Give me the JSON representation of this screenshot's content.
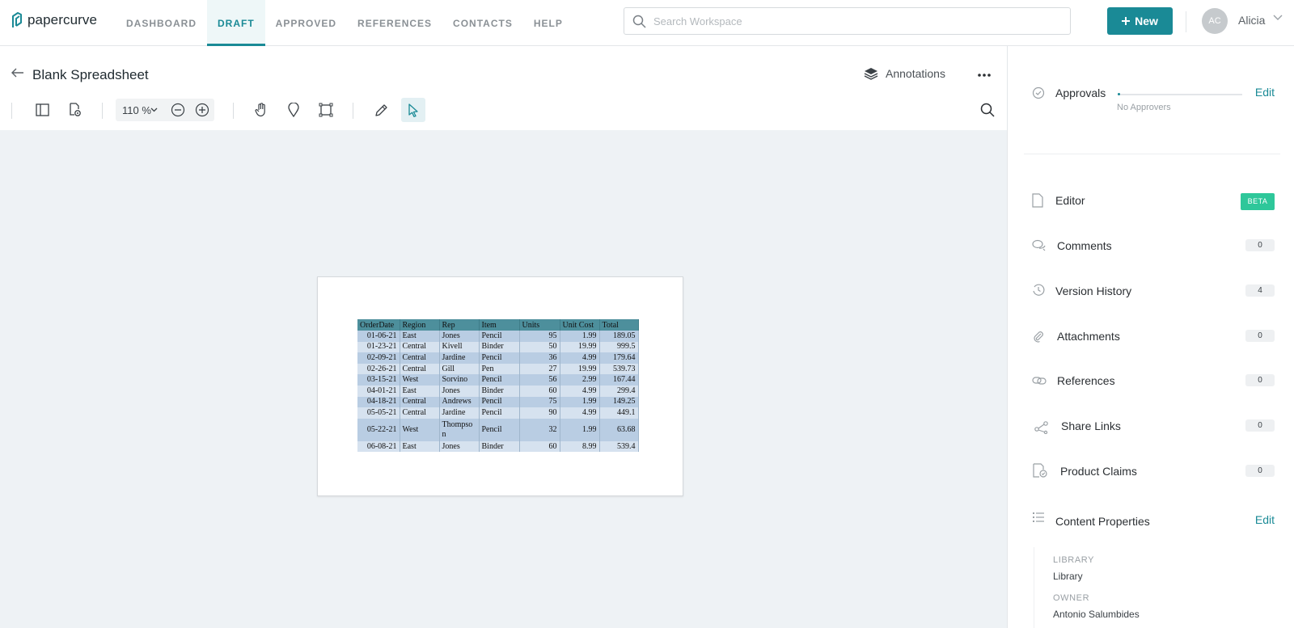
{
  "app": {
    "logo_text": "papercurve"
  },
  "nav": {
    "items": [
      {
        "label": "DASHBOARD"
      },
      {
        "label": "DRAFT",
        "active": true
      },
      {
        "label": "APPROVED"
      },
      {
        "label": "REFERENCES"
      },
      {
        "label": "CONTACTS"
      },
      {
        "label": "HELP"
      }
    ]
  },
  "search": {
    "placeholder": "Search Workspace",
    "value": ""
  },
  "new_button": {
    "label": "New"
  },
  "user": {
    "initials": "AC",
    "name": "Alicia"
  },
  "document": {
    "title": "Blank Spreadsheet",
    "annotations_label": "Annotations",
    "zoom_value": "110",
    "zoom_unit": "%"
  },
  "spreadsheet": {
    "headers": [
      "OrderDate",
      "Region",
      "Rep",
      "Item",
      "Units",
      "Unit Cost",
      "Total"
    ],
    "rows": [
      [
        "01-06-21",
        "East",
        "Jones",
        "Pencil",
        "95",
        "1.99",
        "189.05"
      ],
      [
        "01-23-21",
        "Central",
        "Kivell",
        "Binder",
        "50",
        "19.99",
        "999.5"
      ],
      [
        "02-09-21",
        "Central",
        "Jardine",
        "Pencil",
        "36",
        "4.99",
        "179.64"
      ],
      [
        "02-26-21",
        "Central",
        "Gill",
        "Pen",
        "27",
        "19.99",
        "539.73"
      ],
      [
        "03-15-21",
        "West",
        "Sorvino",
        "Pencil",
        "56",
        "2.99",
        "167.44"
      ],
      [
        "04-01-21",
        "East",
        "Jones",
        "Binder",
        "60",
        "4.99",
        "299.4"
      ],
      [
        "04-18-21",
        "Central",
        "Andrews",
        "Pencil",
        "75",
        "1.99",
        "149.25"
      ],
      [
        "05-05-21",
        "Central",
        "Jardine",
        "Pencil",
        "90",
        "4.99",
        "449.1"
      ],
      [
        "05-22-21",
        "West",
        "Thompson",
        "Pencil",
        "32",
        "1.99",
        "63.68"
      ],
      [
        "06-08-21",
        "East",
        "Jones",
        "Binder",
        "60",
        "8.99",
        "539.4"
      ]
    ]
  },
  "sidebar": {
    "approvals": {
      "label": "Approvals",
      "edit": "Edit",
      "status": "No Approvers"
    },
    "editor": {
      "label": "Editor",
      "badge": "BETA"
    },
    "items": [
      {
        "label": "Comments",
        "count": "0",
        "icon": "comments-icon"
      },
      {
        "label": "Version History",
        "count": "4",
        "icon": "history-icon"
      },
      {
        "label": "Attachments",
        "count": "0",
        "icon": "paperclip-icon"
      },
      {
        "label": "References",
        "count": "0",
        "icon": "link-icon"
      },
      {
        "label": "Share Links",
        "count": "0",
        "icon": "share-icon"
      },
      {
        "label": "Product Claims",
        "count": "0",
        "icon": "claims-icon"
      }
    ],
    "content_properties": {
      "label": "Content Properties",
      "edit": "Edit",
      "library_key": "LIBRARY",
      "library_value": "Library",
      "owner_key": "OWNER",
      "owner_value": "Antonio Salumbides"
    }
  },
  "colors": {
    "accent": "#1a8a96",
    "beta": "#2ec79a",
    "canvas": "#eef2f5",
    "sheet_header": "#4d8f9c"
  }
}
